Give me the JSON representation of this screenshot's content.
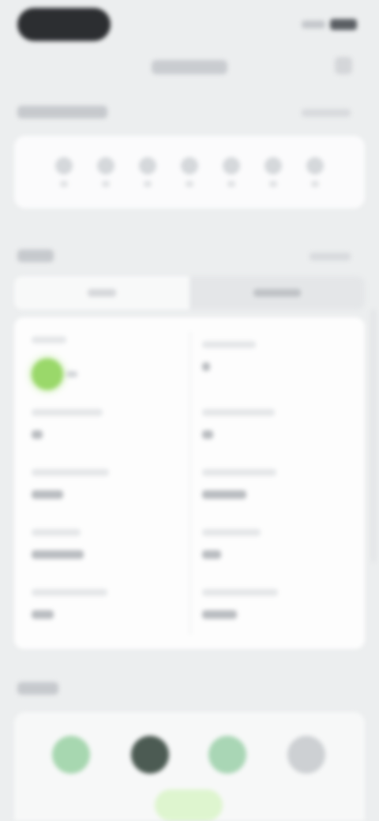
{
  "status_bar": {
    "icons": [
      "signal-icon",
      "battery-icon"
    ]
  },
  "header": {
    "title": "",
    "action_icon": "more-icon"
  },
  "week_section": {
    "title": "",
    "link": "",
    "days": 7
  },
  "details_section": {
    "title": "",
    "link": "",
    "tabs": [
      {
        "label": "",
        "active": true
      },
      {
        "label": "",
        "active": false
      }
    ],
    "status_color": "#9ad86a"
  },
  "bottom_section": {
    "title": "",
    "nav": [
      {
        "icon": "leaf-icon",
        "color": "#9fd4a8"
      },
      {
        "icon": "moon-icon",
        "color": "#4a5a52"
      },
      {
        "icon": "plant-icon",
        "color": "#a9d6b5"
      },
      {
        "icon": "gear-icon",
        "color": "#c9cccf"
      }
    ]
  },
  "colors": {
    "background": "#eceeef",
    "card": "#fdfdfd",
    "accent": "#9ad86a"
  }
}
